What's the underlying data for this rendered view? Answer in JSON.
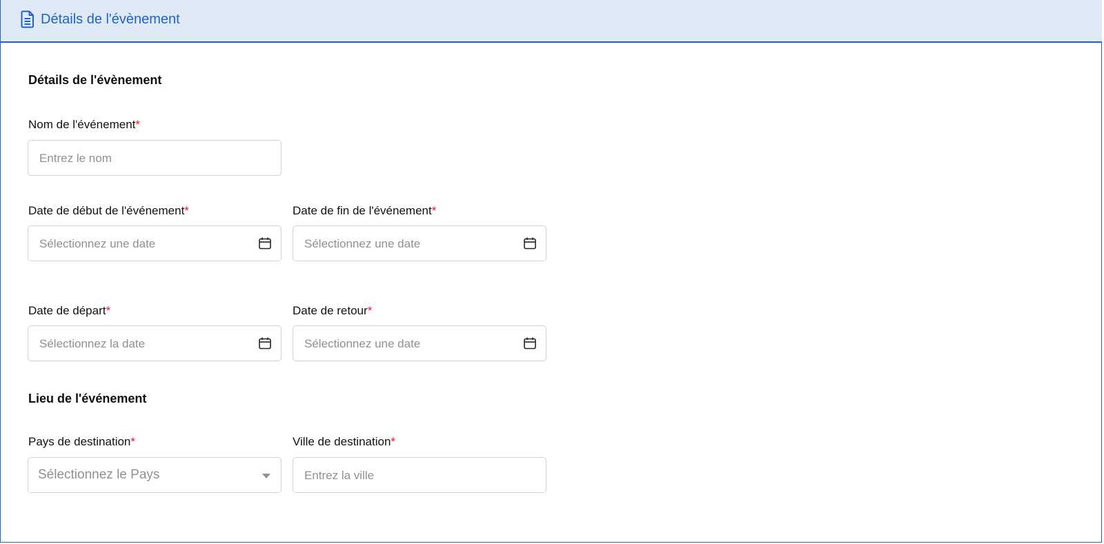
{
  "header": {
    "title": "Détails de l'évènement",
    "icon": "document-icon",
    "accent_color": "#1f63c6",
    "background_color": "#dfeaf6"
  },
  "section_details": {
    "title": "Détails de l'évènement"
  },
  "fields": {
    "event_name": {
      "label": "Nom de l'événement",
      "required_mark": "*",
      "placeholder": "Entrez le nom",
      "value": ""
    },
    "start_date": {
      "label": "Date de début de l'événement",
      "required_mark": "*",
      "placeholder": "Sélectionnez une date",
      "icon": "calendar-icon"
    },
    "end_date": {
      "label": "Date de fin de l'événement",
      "required_mark": "*",
      "placeholder": "Sélectionnez une date",
      "icon": "calendar-icon"
    },
    "departure_date": {
      "label": "Date de départ",
      "required_mark": "*",
      "placeholder": "Sélectionnez la date",
      "icon": "calendar-icon"
    },
    "return_date": {
      "label": "Date de retour",
      "required_mark": "*",
      "placeholder": "Sélectionnez une date",
      "icon": "calendar-icon"
    },
    "country": {
      "label": "Pays de destination",
      "required_mark": "*",
      "placeholder": "Sélectionnez le Pays",
      "icon": "chevron-down-icon"
    },
    "city": {
      "label": "Ville de destination",
      "required_mark": "*",
      "placeholder": "Entrez la ville",
      "value": ""
    }
  },
  "section_location": {
    "title": "Lieu de l'événement"
  },
  "required_color": "#e0182d"
}
